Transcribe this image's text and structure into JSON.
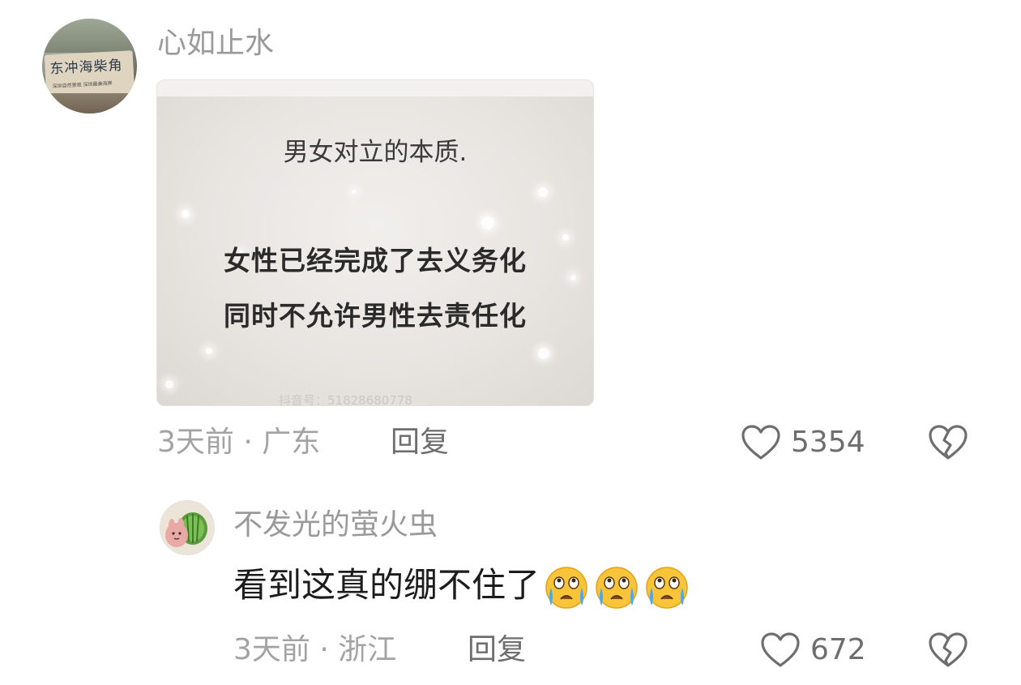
{
  "comments": [
    {
      "username": "心如止水",
      "avatar_text": "东冲海柴角",
      "avatar_small_text": "深圳自然景观  深圳最美海岸",
      "image": {
        "heading": "男女对立的本质.",
        "line1": "女性已经完成了去义务化",
        "line2": "同时不允许男性去责任化",
        "watermark": "抖音号：51828680778"
      },
      "time": "3天前",
      "separator": "·",
      "location": "广东",
      "reply_label": "回复",
      "like_count": "5354"
    },
    {
      "username": "不发光的萤火虫",
      "text": "看到这真的绷不住了",
      "emojis": [
        "crying-face-icon",
        "crying-face-icon",
        "crying-face-icon"
      ],
      "time": "3天前",
      "separator": "·",
      "location": "浙江",
      "reply_label": "回复",
      "like_count": "672"
    }
  ],
  "colors": {
    "username": "#9a9a9a",
    "meta": "#a3a3a3",
    "action": "#6e6e6e",
    "body_text": "#1c1c1c"
  }
}
